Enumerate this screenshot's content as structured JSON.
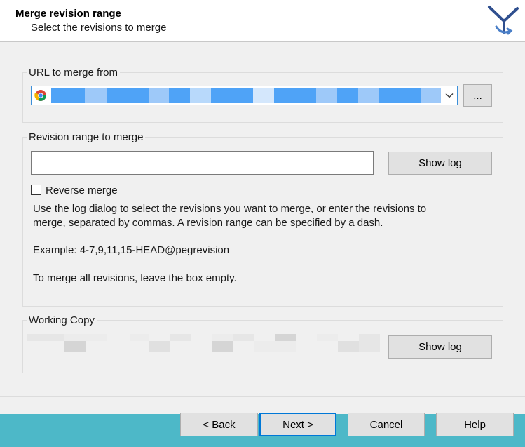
{
  "header": {
    "title": "Merge revision range",
    "subtitle": "Select the revisions to merge"
  },
  "url_group": {
    "label": "URL to merge from",
    "browse_label": "..."
  },
  "range_group": {
    "label": "Revision range to merge",
    "input_value": "",
    "show_log_label": "Show log",
    "reverse_merge_label": "Reverse merge",
    "reverse_merge_checked": false,
    "help_line1": "Use the log dialog to select the revisions you want to merge, or enter the revisions to",
    "help_line2": "merge, separated by commas. A revision range can be specified by a dash.",
    "example": "Example: 4-7,9,11,15-HEAD@pegrevision",
    "empty_hint": "To merge all revisions, leave the box empty."
  },
  "working_copy_group": {
    "label": "Working Copy",
    "show_log_label": "Show log"
  },
  "buttons": {
    "back_prefix": "< ",
    "back_mnemonic": "B",
    "back_rest": "ack",
    "next_mnemonic": "N",
    "next_rest": "ext >",
    "cancel": "Cancel",
    "help": "Help"
  },
  "colors": {
    "footer": "#4db8c8",
    "focus_border": "#3b8fd9",
    "logo": "#2f4f8f"
  }
}
